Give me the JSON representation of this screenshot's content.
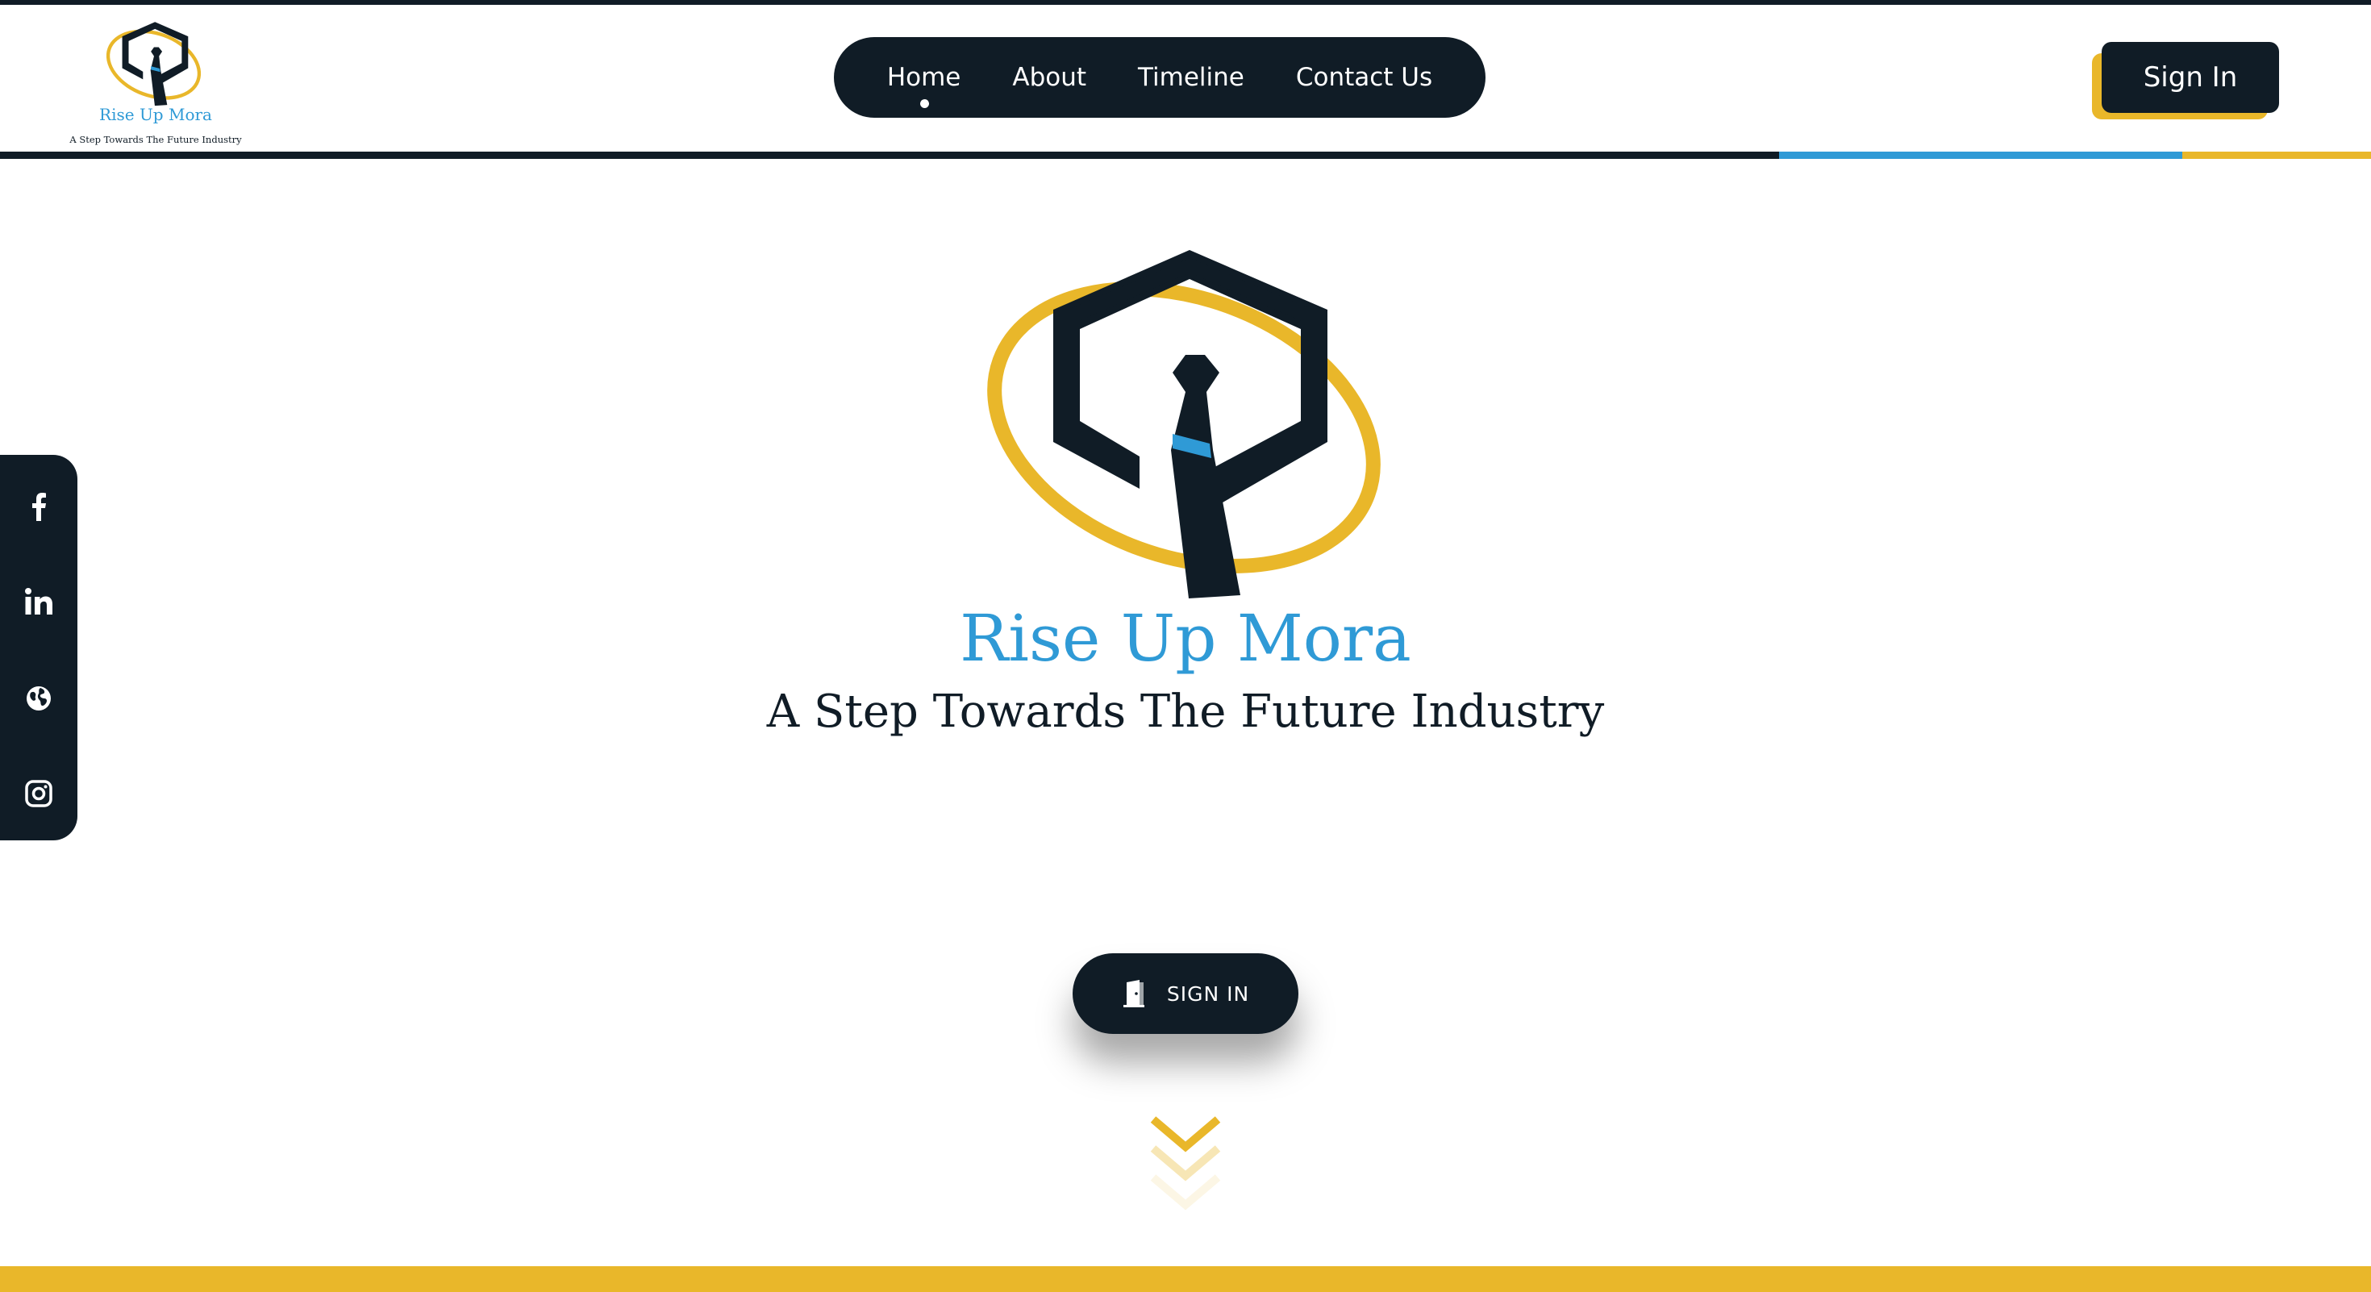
{
  "brand": {
    "name": "Rise Up Mora",
    "tagline": "A Step Towards The Future Industry"
  },
  "nav": {
    "items": [
      {
        "label": "Home",
        "active": true
      },
      {
        "label": "About",
        "active": false
      },
      {
        "label": "Timeline",
        "active": false
      },
      {
        "label": "Contact Us",
        "active": false
      }
    ]
  },
  "header": {
    "sign_in_label": "Sign In"
  },
  "social": {
    "icons": [
      "facebook-icon",
      "linkedin-icon",
      "globe-icon",
      "instagram-icon"
    ]
  },
  "hero": {
    "title": "Rise Up Mora",
    "tagline": "A Step Towards The Future Industry",
    "cta_label": "SIGN IN",
    "cta_icon": "door-icon",
    "scroll_icon": "chevrons-down-icon"
  },
  "colors": {
    "navy": "#101c26",
    "blue": "#2f9ad6",
    "gold": "#e9b72a",
    "background": "#ffffff"
  }
}
